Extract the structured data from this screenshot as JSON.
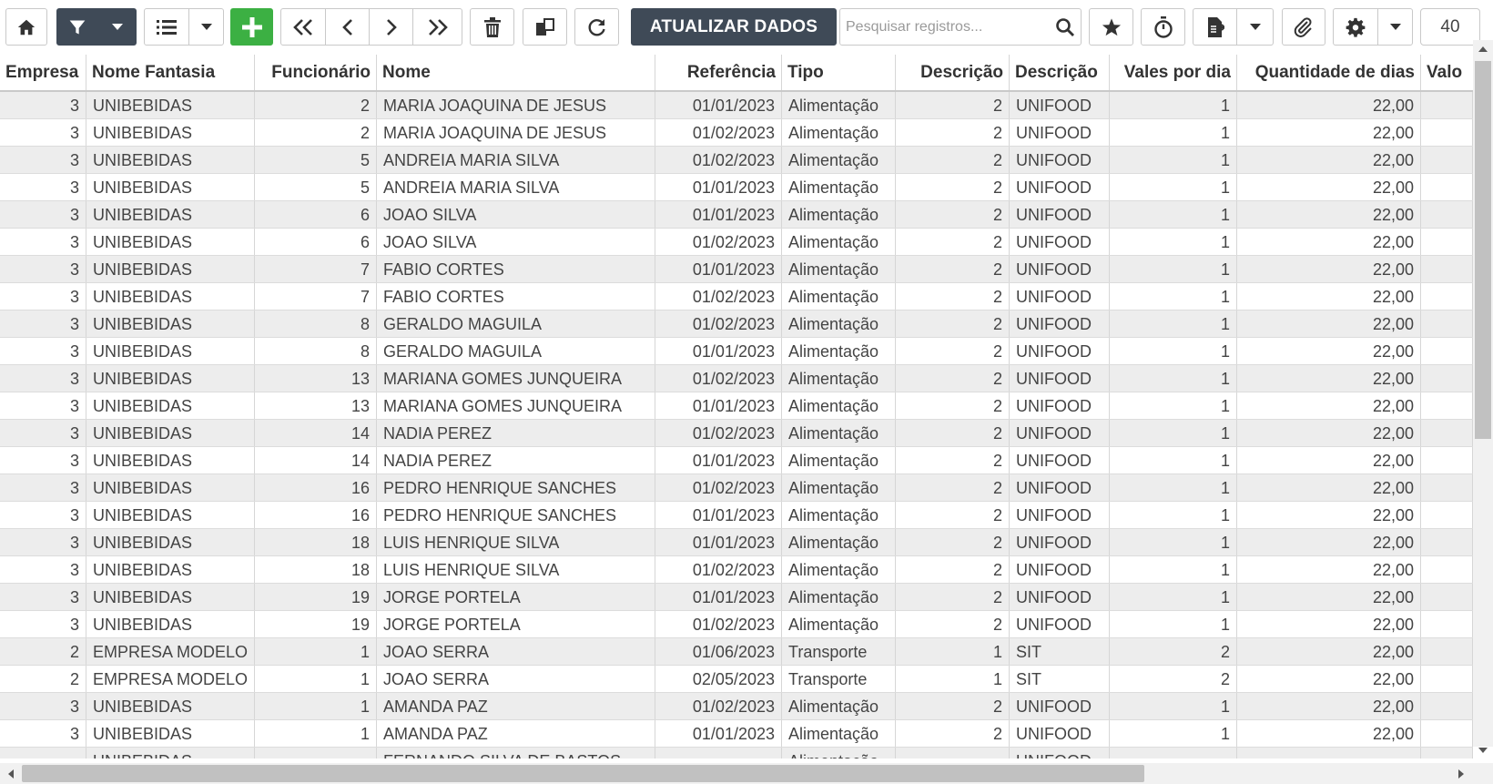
{
  "toolbar": {
    "refresh_data_label": "ATUALIZAR DADOS",
    "search_placeholder": "Pesquisar registros...",
    "page_size": "40"
  },
  "columns": [
    {
      "label": "Empresa"
    },
    {
      "label": "Nome Fantasia"
    },
    {
      "label": "Funcionário"
    },
    {
      "label": "Nome"
    },
    {
      "label": "Referência"
    },
    {
      "label": "Tipo"
    },
    {
      "label": "Descrição"
    },
    {
      "label": "Descrição"
    },
    {
      "label": "Vales por dia"
    },
    {
      "label": "Quantidade de dias"
    },
    {
      "label": "Valo"
    }
  ],
  "rows": [
    {
      "empresa": "3",
      "fantasia": "UNIBEBIDAS",
      "func": "2",
      "nome": "MARIA JOAQUINA DE JESUS",
      "ref": "01/01/2023",
      "tipo": "Alimentação",
      "desc1": "2",
      "desc2": "UNIFOOD",
      "vales": "1",
      "dias": "22,00"
    },
    {
      "empresa": "3",
      "fantasia": "UNIBEBIDAS",
      "func": "2",
      "nome": "MARIA JOAQUINA DE JESUS",
      "ref": "01/02/2023",
      "tipo": "Alimentação",
      "desc1": "2",
      "desc2": "UNIFOOD",
      "vales": "1",
      "dias": "22,00"
    },
    {
      "empresa": "3",
      "fantasia": "UNIBEBIDAS",
      "func": "5",
      "nome": "ANDREIA MARIA SILVA",
      "ref": "01/02/2023",
      "tipo": "Alimentação",
      "desc1": "2",
      "desc2": "UNIFOOD",
      "vales": "1",
      "dias": "22,00"
    },
    {
      "empresa": "3",
      "fantasia": "UNIBEBIDAS",
      "func": "5",
      "nome": "ANDREIA MARIA SILVA",
      "ref": "01/01/2023",
      "tipo": "Alimentação",
      "desc1": "2",
      "desc2": "UNIFOOD",
      "vales": "1",
      "dias": "22,00"
    },
    {
      "empresa": "3",
      "fantasia": "UNIBEBIDAS",
      "func": "6",
      "nome": "JOAO SILVA",
      "ref": "01/01/2023",
      "tipo": "Alimentação",
      "desc1": "2",
      "desc2": "UNIFOOD",
      "vales": "1",
      "dias": "22,00"
    },
    {
      "empresa": "3",
      "fantasia": "UNIBEBIDAS",
      "func": "6",
      "nome": "JOAO SILVA",
      "ref": "01/02/2023",
      "tipo": "Alimentação",
      "desc1": "2",
      "desc2": "UNIFOOD",
      "vales": "1",
      "dias": "22,00"
    },
    {
      "empresa": "3",
      "fantasia": "UNIBEBIDAS",
      "func": "7",
      "nome": "FABIO CORTES",
      "ref": "01/01/2023",
      "tipo": "Alimentação",
      "desc1": "2",
      "desc2": "UNIFOOD",
      "vales": "1",
      "dias": "22,00"
    },
    {
      "empresa": "3",
      "fantasia": "UNIBEBIDAS",
      "func": "7",
      "nome": "FABIO CORTES",
      "ref": "01/02/2023",
      "tipo": "Alimentação",
      "desc1": "2",
      "desc2": "UNIFOOD",
      "vales": "1",
      "dias": "22,00"
    },
    {
      "empresa": "3",
      "fantasia": "UNIBEBIDAS",
      "func": "8",
      "nome": "GERALDO MAGUILA",
      "ref": "01/02/2023",
      "tipo": "Alimentação",
      "desc1": "2",
      "desc2": "UNIFOOD",
      "vales": "1",
      "dias": "22,00"
    },
    {
      "empresa": "3",
      "fantasia": "UNIBEBIDAS",
      "func": "8",
      "nome": "GERALDO MAGUILA",
      "ref": "01/01/2023",
      "tipo": "Alimentação",
      "desc1": "2",
      "desc2": "UNIFOOD",
      "vales": "1",
      "dias": "22,00"
    },
    {
      "empresa": "3",
      "fantasia": "UNIBEBIDAS",
      "func": "13",
      "nome": "MARIANA GOMES JUNQUEIRA",
      "ref": "01/02/2023",
      "tipo": "Alimentação",
      "desc1": "2",
      "desc2": "UNIFOOD",
      "vales": "1",
      "dias": "22,00"
    },
    {
      "empresa": "3",
      "fantasia": "UNIBEBIDAS",
      "func": "13",
      "nome": "MARIANA GOMES JUNQUEIRA",
      "ref": "01/01/2023",
      "tipo": "Alimentação",
      "desc1": "2",
      "desc2": "UNIFOOD",
      "vales": "1",
      "dias": "22,00"
    },
    {
      "empresa": "3",
      "fantasia": "UNIBEBIDAS",
      "func": "14",
      "nome": "NADIA PEREZ",
      "ref": "01/02/2023",
      "tipo": "Alimentação",
      "desc1": "2",
      "desc2": "UNIFOOD",
      "vales": "1",
      "dias": "22,00"
    },
    {
      "empresa": "3",
      "fantasia": "UNIBEBIDAS",
      "func": "14",
      "nome": "NADIA PEREZ",
      "ref": "01/01/2023",
      "tipo": "Alimentação",
      "desc1": "2",
      "desc2": "UNIFOOD",
      "vales": "1",
      "dias": "22,00"
    },
    {
      "empresa": "3",
      "fantasia": "UNIBEBIDAS",
      "func": "16",
      "nome": "PEDRO HENRIQUE SANCHES",
      "ref": "01/02/2023",
      "tipo": "Alimentação",
      "desc1": "2",
      "desc2": "UNIFOOD",
      "vales": "1",
      "dias": "22,00"
    },
    {
      "empresa": "3",
      "fantasia": "UNIBEBIDAS",
      "func": "16",
      "nome": "PEDRO HENRIQUE SANCHES",
      "ref": "01/01/2023",
      "tipo": "Alimentação",
      "desc1": "2",
      "desc2": "UNIFOOD",
      "vales": "1",
      "dias": "22,00"
    },
    {
      "empresa": "3",
      "fantasia": "UNIBEBIDAS",
      "func": "18",
      "nome": "LUIS HENRIQUE SILVA",
      "ref": "01/01/2023",
      "tipo": "Alimentação",
      "desc1": "2",
      "desc2": "UNIFOOD",
      "vales": "1",
      "dias": "22,00"
    },
    {
      "empresa": "3",
      "fantasia": "UNIBEBIDAS",
      "func": "18",
      "nome": "LUIS HENRIQUE SILVA",
      "ref": "01/02/2023",
      "tipo": "Alimentação",
      "desc1": "2",
      "desc2": "UNIFOOD",
      "vales": "1",
      "dias": "22,00"
    },
    {
      "empresa": "3",
      "fantasia": "UNIBEBIDAS",
      "func": "19",
      "nome": "JORGE PORTELA",
      "ref": "01/01/2023",
      "tipo": "Alimentação",
      "desc1": "2",
      "desc2": "UNIFOOD",
      "vales": "1",
      "dias": "22,00"
    },
    {
      "empresa": "3",
      "fantasia": "UNIBEBIDAS",
      "func": "19",
      "nome": "JORGE PORTELA",
      "ref": "01/02/2023",
      "tipo": "Alimentação",
      "desc1": "2",
      "desc2": "UNIFOOD",
      "vales": "1",
      "dias": "22,00"
    },
    {
      "empresa": "2",
      "fantasia": "EMPRESA MODELO",
      "func": "1",
      "nome": "JOAO SERRA",
      "ref": "01/06/2023",
      "tipo": "Transporte",
      "desc1": "1",
      "desc2": "SIT",
      "vales": "2",
      "dias": "22,00"
    },
    {
      "empresa": "2",
      "fantasia": "EMPRESA MODELO",
      "func": "1",
      "nome": "JOAO SERRA",
      "ref": "02/05/2023",
      "tipo": "Transporte",
      "desc1": "1",
      "desc2": "SIT",
      "vales": "2",
      "dias": "22,00"
    },
    {
      "empresa": "3",
      "fantasia": "UNIBEBIDAS",
      "func": "1",
      "nome": "AMANDA PAZ",
      "ref": "01/02/2023",
      "tipo": "Alimentação",
      "desc1": "2",
      "desc2": "UNIFOOD",
      "vales": "1",
      "dias": "22,00"
    },
    {
      "empresa": "3",
      "fantasia": "UNIBEBIDAS",
      "func": "1",
      "nome": "AMANDA PAZ",
      "ref": "01/01/2023",
      "tipo": "Alimentação",
      "desc1": "2",
      "desc2": "UNIFOOD",
      "vales": "1",
      "dias": "22,00"
    },
    {
      "empresa": "",
      "fantasia": "UNIBEBIDAS",
      "func": "",
      "nome": "FERNANDO SILVA DE BASTOS",
      "ref": "",
      "tipo": "Alimentação",
      "desc1": "",
      "desc2": "UNIFOOD",
      "vales": "",
      "dias": ""
    }
  ],
  "icons": {
    "home": "home-icon",
    "filter": "filter-icon",
    "list": "list-icon",
    "add": "plus-icon",
    "first": "double-chevron-left-icon",
    "prev": "chevron-left-icon",
    "next": "chevron-right-icon",
    "last": "double-chevron-right-icon",
    "delete": "trash-icon",
    "copy": "copy-icon",
    "reload": "refresh-icon",
    "search": "search-icon",
    "favorite": "star-icon",
    "timer": "stopwatch-icon",
    "export": "export-file-icon",
    "attach": "paperclip-icon",
    "settings": "gear-icon",
    "columns_menu": "hamburger-menu-icon"
  },
  "colors": {
    "toolbar_dark": "#3f4a57",
    "add_green": "#3cb043",
    "row_striped": "#ededed"
  }
}
